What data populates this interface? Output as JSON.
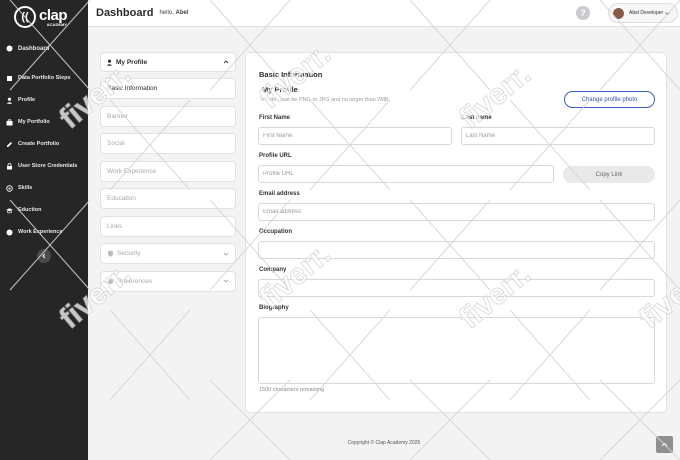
{
  "app": {
    "logo_text": "clap",
    "logo_sub": "ACADEMY"
  },
  "sidebar": {
    "items": [
      {
        "label": "Dashboard",
        "icon": "dashboard-icon"
      },
      {
        "label": "Data Portfolio Steps",
        "icon": "steps-icon"
      },
      {
        "label": "Profile",
        "icon": "user-icon"
      },
      {
        "label": "My Portfolio",
        "icon": "portfolio-icon"
      },
      {
        "label": "Create Portfolio",
        "icon": "create-icon"
      },
      {
        "label": "User Store Credentials",
        "icon": "credentials-icon"
      },
      {
        "label": "Skills",
        "icon": "skills-icon"
      },
      {
        "label": "Eduction",
        "icon": "education-icon"
      },
      {
        "label": "Work Experience",
        "icon": "briefcase-icon"
      }
    ]
  },
  "header": {
    "title": "Dashboard",
    "greeting_prefix": "hello,",
    "greeting_name": "Abel",
    "user_name": "Abel Developer"
  },
  "menu": {
    "head_label": "My Profile",
    "items": [
      {
        "label": "Basic Information",
        "active": true
      },
      {
        "label": "Banner"
      },
      {
        "label": "Social"
      },
      {
        "label": "Work Experience"
      },
      {
        "label": "Education"
      },
      {
        "label": "Links"
      },
      {
        "label": "Security"
      },
      {
        "label": "Preferences"
      }
    ]
  },
  "form": {
    "card_title": "Basic Information",
    "section_title": "My Profile",
    "photo_hint": "Photo must be PNG or JPG and no larger than 2MB",
    "change_photo_label": "Change profile photo",
    "first_name_label": "First Name",
    "first_name_placeholder": "First Name",
    "last_name_label": "Last name",
    "last_name_placeholder": "Last Name",
    "profile_url_label": "Profile URL",
    "profile_url_placeholder": "Profile URL",
    "copy_link_label": "Copy Link",
    "email_label": "Email address",
    "email_placeholder": "Email address",
    "occupation_label": "Occupation",
    "company_label": "Company",
    "biography_label": "Biography",
    "chars_remaining": "1500 characters remaining"
  },
  "footer": {
    "copyright": "Copyright © Clap Academy 2025"
  },
  "watermark": {
    "text": "fiverr."
  },
  "colors": {
    "sidebar_bg": "#262626",
    "accent": "#2f4fb8",
    "page_bg": "#f3f3f4"
  }
}
